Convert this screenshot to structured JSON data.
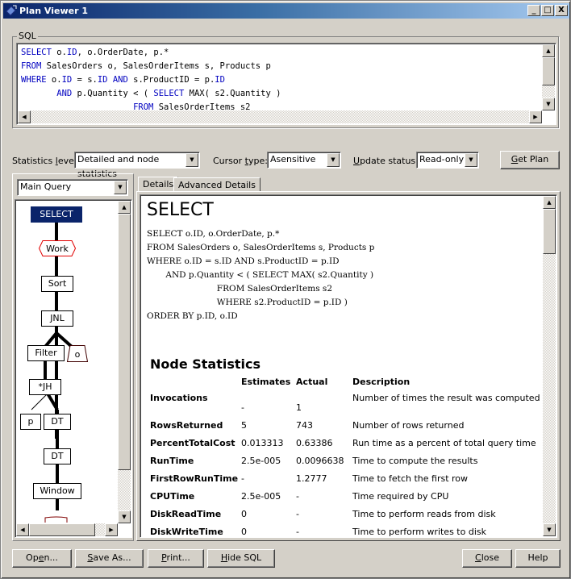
{
  "window": {
    "title": "Plan Viewer 1",
    "controls": {
      "minimize": "_",
      "maximize": "□",
      "close": "X"
    }
  },
  "sql_group": {
    "label": "SQL",
    "lines": [
      [
        {
          "t": "SELECT",
          "k": true
        },
        {
          "t": " o."
        },
        {
          "t": "ID",
          "k": true
        },
        {
          "t": ", o.OrderDate, p.*"
        }
      ],
      [
        {
          "t": "FROM",
          "k": true
        },
        {
          "t": " SalesOrders o, SalesOrderItems s, Products p"
        }
      ],
      [
        {
          "t": "WHERE",
          "k": true
        },
        {
          "t": " o."
        },
        {
          "t": "ID",
          "k": true
        },
        {
          "t": " = s."
        },
        {
          "t": "ID",
          "k": true
        },
        {
          "t": " "
        },
        {
          "t": "AND",
          "k": true
        },
        {
          "t": " s.ProductID = p."
        },
        {
          "t": "ID",
          "k": true
        }
      ],
      [
        {
          "t": "       "
        },
        {
          "t": "AND",
          "k": true
        },
        {
          "t": " p.Quantity < ( "
        },
        {
          "t": "SELECT",
          "k": true
        },
        {
          "t": " MAX( s2.Quantity )"
        }
      ],
      [
        {
          "t": "                      "
        },
        {
          "t": "FROM",
          "k": true
        },
        {
          "t": " SalesOrderItems s2"
        }
      ]
    ]
  },
  "options": {
    "statistics_level_label": "Statistics level:",
    "statistics_level_value": "Detailed and node statistics",
    "cursor_type_label": "Cursor type:",
    "cursor_type_value": "Asensitive",
    "update_status_label": "Update status:",
    "update_status_value": "Read-only",
    "get_plan_button": "Get Plan"
  },
  "plan_tree": {
    "query_selector": "Main Query",
    "nodes": {
      "select": "SELECT",
      "work": "Work",
      "sort": "Sort",
      "jnl": "JNL",
      "filter": "Filter",
      "o": "o",
      "jh": "*JH",
      "p": "p",
      "dt1": "DT",
      "dt2": "DT",
      "window": "Window"
    }
  },
  "tabs": [
    {
      "label": "Details",
      "active": true
    },
    {
      "label": "Advanced Details",
      "active": false
    }
  ],
  "details": {
    "heading": "SELECT",
    "sql": "SELECT o.ID, o.OrderDate, p.*\nFROM SalesOrders o, SalesOrderItems s, Products p\nWHERE o.ID = s.ID AND s.ProductID = p.ID\n       AND p.Quantity < ( SELECT MAX( s2.Quantity )\n                          FROM SalesOrderItems s2\n                          WHERE s2.ProductID = p.ID )\nORDER BY p.ID, o.ID",
    "node_statistics": {
      "title": "Node Statistics",
      "columns": [
        "",
        "Estimates",
        "Actual",
        "Description"
      ],
      "rows": [
        {
          "name": "Invocations",
          "estimate": "-",
          "actual": "1",
          "description": "Number of times the result was computed"
        },
        {
          "name": "RowsReturned",
          "estimate": "5",
          "actual": "743",
          "description": "Number of rows returned"
        },
        {
          "name": "PercentTotalCost",
          "estimate": "0.013313",
          "actual": "0.63386",
          "description": "Run time as a percent of total query time"
        },
        {
          "name": "RunTime",
          "estimate": "2.5e-005",
          "actual": "0.0096638",
          "description": "Time to compute the results"
        },
        {
          "name": "FirstRowRunTime",
          "estimate": "-",
          "actual": "1.2777",
          "description": "Time to fetch the first row"
        },
        {
          "name": "CPUTime",
          "estimate": "2.5e-005",
          "actual": "-",
          "description": "Time required by CPU"
        },
        {
          "name": "DiskReadTime",
          "estimate": "0",
          "actual": "-",
          "description": "Time to perform reads from disk"
        },
        {
          "name": "DiskWriteTime",
          "estimate": "0",
          "actual": "-",
          "description": "Time to perform writes to disk"
        }
      ]
    }
  },
  "footer": {
    "open": "Open...",
    "save_as": "Save As...",
    "print": "Print...",
    "hide_sql": "Hide SQL",
    "close": "Close",
    "help": "Help"
  },
  "colors": {
    "sql_keyword": "#0000c0",
    "select_node": "#0a246a",
    "work_node_border": "#e00000"
  }
}
